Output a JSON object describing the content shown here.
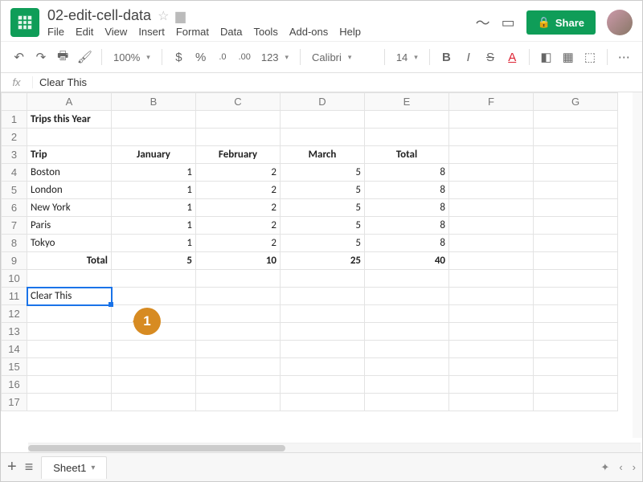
{
  "doc": {
    "title": "02-edit-cell-data"
  },
  "menu": [
    "File",
    "Edit",
    "View",
    "Insert",
    "Format",
    "Data",
    "Tools",
    "Add-ons",
    "Help"
  ],
  "share_label": "Share",
  "toolbar": {
    "zoom": "100%",
    "currency": "$",
    "percent": "%",
    "dec_dec": ".0",
    "dec_inc": ".00",
    "num_fmt": "123",
    "font": "Calibri",
    "size": "14"
  },
  "formula": {
    "fx": "fx",
    "value": "Clear This"
  },
  "columns": [
    "A",
    "B",
    "C",
    "D",
    "E",
    "F",
    "G"
  ],
  "rows": [
    "1",
    "2",
    "3",
    "4",
    "5",
    "6",
    "7",
    "8",
    "9",
    "10",
    "11",
    "12",
    "13",
    "14",
    "15",
    "16",
    "17"
  ],
  "cells": {
    "A1": "Trips this Year",
    "A3": "Trip",
    "B3": "January",
    "C3": "February",
    "D3": "March",
    "E3": "Total",
    "A4": "Boston",
    "B4": "1",
    "C4": "2",
    "D4": "5",
    "E4": "8",
    "A5": "London",
    "B5": "1",
    "C5": "2",
    "D5": "5",
    "E5": "8",
    "A6": "New York",
    "B6": "1",
    "C6": "2",
    "D6": "5",
    "E6": "8",
    "A7": "Paris",
    "B7": "1",
    "C7": "2",
    "D7": "5",
    "E7": "8",
    "A8": "Tokyo",
    "B8": "1",
    "C8": "2",
    "D8": "5",
    "E8": "8",
    "A9": "Total",
    "B9": "5",
    "C9": "10",
    "D9": "25",
    "E9": "40",
    "A11": "Clear This"
  },
  "callout": "1",
  "sheet_tab": "Sheet1"
}
